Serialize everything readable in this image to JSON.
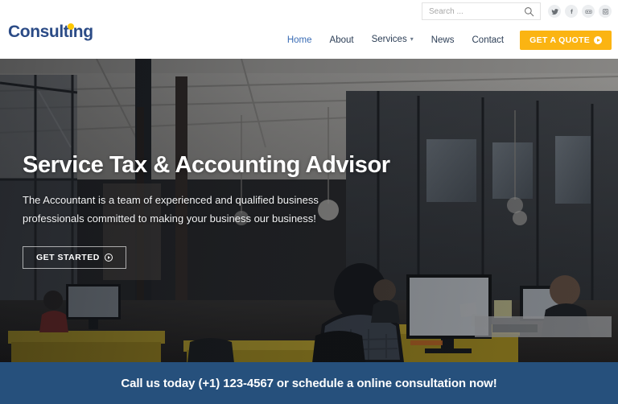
{
  "header": {
    "logo": {
      "text": "Consulting",
      "color": "#2b4b86",
      "dot_color": "#fdc700"
    },
    "search": {
      "placeholder": "Search ...",
      "value": "",
      "icon": "search-icon"
    },
    "socials": [
      {
        "name": "twitter-icon",
        "label": "Twitter"
      },
      {
        "name": "facebook-icon",
        "label": "Facebook"
      },
      {
        "name": "flickr-icon",
        "label": "Flickr"
      },
      {
        "name": "instagram-icon",
        "label": "Instagram"
      }
    ],
    "nav": [
      {
        "label": "Home",
        "active": true,
        "caret": false
      },
      {
        "label": "About",
        "active": false,
        "caret": false
      },
      {
        "label": "Services",
        "active": false,
        "caret": true
      },
      {
        "label": "News",
        "active": false,
        "caret": false
      },
      {
        "label": "Contact",
        "active": false,
        "caret": false
      }
    ],
    "quote_button": {
      "label": "GET A QUOTE",
      "icon": "circle-arrow-icon",
      "bg": "#fbb412"
    }
  },
  "hero": {
    "title": "Service Tax & Accounting Advisor",
    "subtitle": "The Accountant is a team of experienced and qualified business professionals committed to making your business our business!",
    "button": {
      "label": "GET STARTED",
      "icon": "circle-arrow-icon"
    },
    "image_alt": "open-plan office with people working at yellow desks and monitors"
  },
  "cta": {
    "text": "Call us today (+1) 123-4567 or schedule a online consultation now!",
    "bg": "#26507c"
  }
}
